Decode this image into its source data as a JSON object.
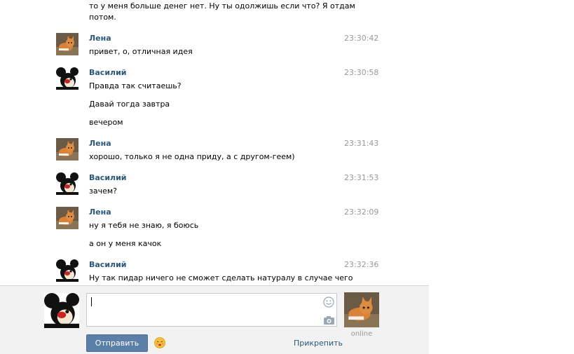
{
  "chat": {
    "top_fragment": [
      "то у меня больше денег нет. Ну ты одолжишь если что? Я отдам",
      "потом."
    ],
    "messages": [
      {
        "author": "Лена",
        "time": "23:30:42",
        "lines": [
          "привет, о, отличная идея"
        ]
      },
      {
        "author": "Василий",
        "time": "23:30:58",
        "lines": [
          "Правда так считаешь?",
          "Давай тогда завтра",
          "вечером"
        ]
      },
      {
        "author": "Лена",
        "time": "23:31:43",
        "lines": [
          "хорошо, только я не одна приду, а с другом-геем)"
        ]
      },
      {
        "author": "Василий",
        "time": "23:31:53",
        "lines": [
          "зачем?"
        ]
      },
      {
        "author": "Лена",
        "time": "23:32:09",
        "lines": [
          "ну я тебя не знаю, я боюсь",
          "а он у меня качок"
        ]
      },
      {
        "author": "Василий",
        "time": "23:32:36",
        "lines": [
          "Ну так пидар ничего не сможет сделать натуралу в случае чего"
        ]
      }
    ]
  },
  "composer": {
    "input_value": "",
    "send_label": "Отправить",
    "attach_label": "Прикрепить"
  },
  "partner": {
    "status": "online"
  },
  "icons": {
    "smile": "smile-icon",
    "camera": "camera-icon",
    "emoji": "emoji-icon"
  },
  "colors": {
    "name": "#2b587a",
    "time": "#999999",
    "button": "#5b7fa6",
    "composer_bg": "#f2f2f2"
  }
}
